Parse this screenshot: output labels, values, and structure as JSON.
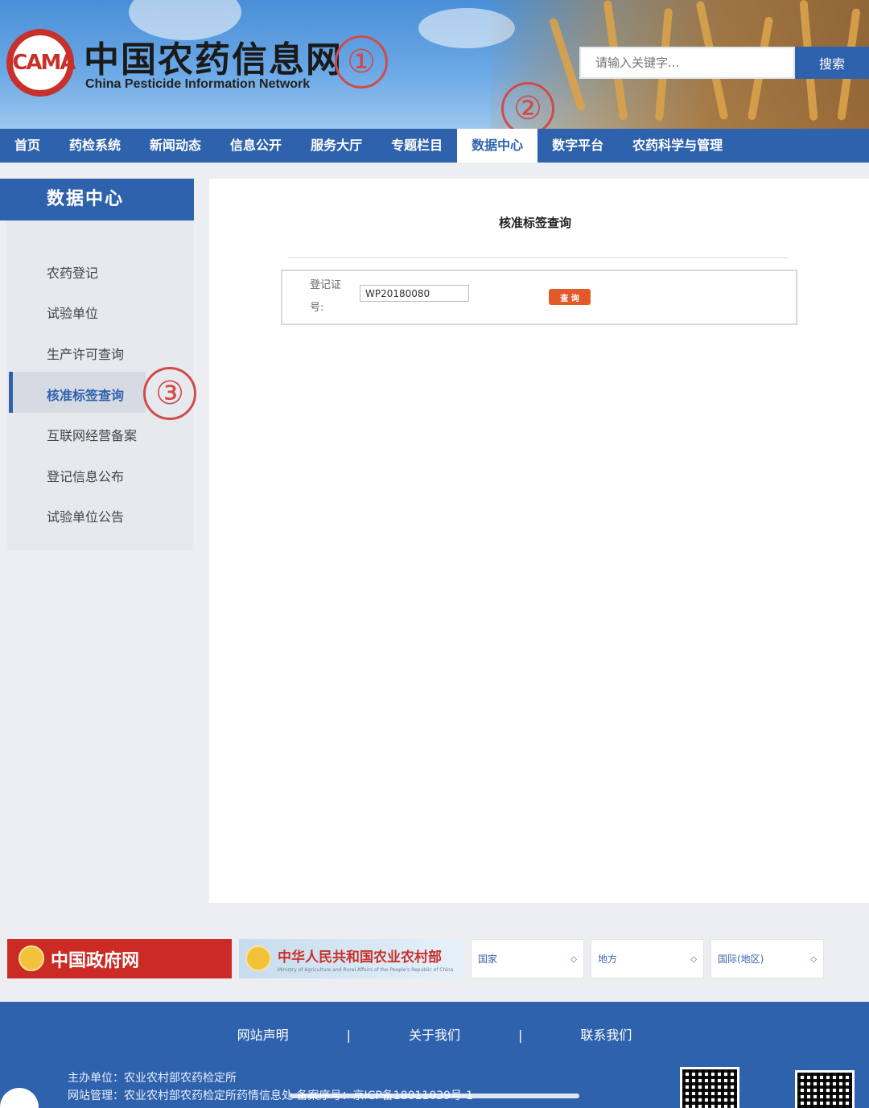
{
  "header": {
    "logo_text": "ICAMA",
    "title_cn": "中国农药信息网",
    "title_en": "China Pesticide Information Network",
    "search_placeholder": "请输入关键字...",
    "search_button": "搜索",
    "markers": [
      "①",
      "②",
      "③"
    ]
  },
  "nav": {
    "items": [
      "首页",
      "药检系统",
      "新闻动态",
      "信息公开",
      "服务大厅",
      "专题栏目",
      "数据中心",
      "数字平台",
      "农药科学与管理"
    ],
    "active": "数据中心"
  },
  "sidebar": {
    "title": "数据中心",
    "items": [
      "农药登记",
      "试验单位",
      "生产许可查询",
      "核准标签查询",
      "互联网经营备案",
      "登记信息公布",
      "试验单位公告"
    ],
    "active": "核准标签查询"
  },
  "main": {
    "title": "核准标签查询",
    "field_label": "登记证号:",
    "field_value": "WP20180080",
    "query_button": "查 询"
  },
  "links_row": {
    "gov_site": "中国政府网",
    "moa_site_cn": "中华人民共和国农业农村部",
    "moa_site_en": "Ministry of Agriculture and Rural Affairs of the People's Republic of China",
    "selects": [
      "国家",
      "地方",
      "国际(地区)"
    ]
  },
  "footer": {
    "links": [
      "网站声明",
      "关于我们",
      "联系我们"
    ],
    "separator": "|",
    "sponsor": "主办单位：农业农村部农药检定所",
    "manager": "网站管理：农业农村部农药检定所药情信息处   备案序号：京ICP备18011039号-1"
  },
  "colors": {
    "primary_blue": "#2f62ad",
    "accent_red": "#c8312b",
    "query_orange": "#e2592a"
  }
}
